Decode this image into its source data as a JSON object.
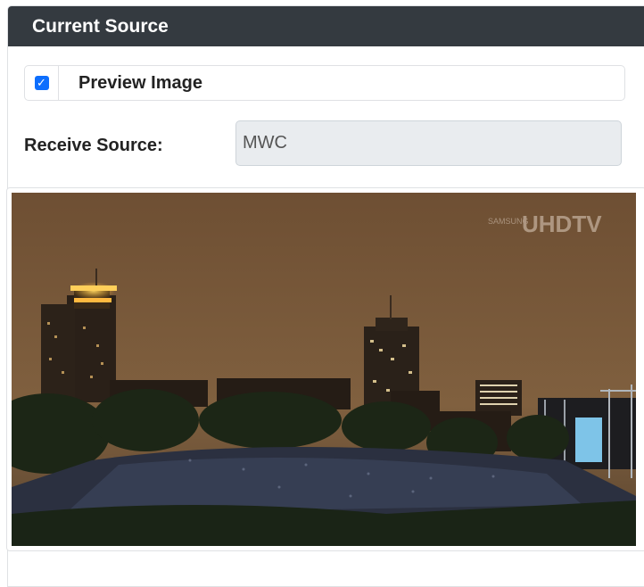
{
  "panel": {
    "title": "Current Source"
  },
  "preview": {
    "checked": true,
    "label": "Preview Image"
  },
  "receive_source": {
    "label": "Receive Source:",
    "value": "MWC"
  },
  "image": {
    "watermark": "UHDTV",
    "watermark_brand": "SAMSUNG",
    "description_colors": {
      "sky": "#7a5838",
      "ground": "#1a2014"
    }
  },
  "colors": {
    "header_bg": "#343a40",
    "checkbox": "#0d6efd",
    "input_disabled_bg": "#e9ecef"
  }
}
